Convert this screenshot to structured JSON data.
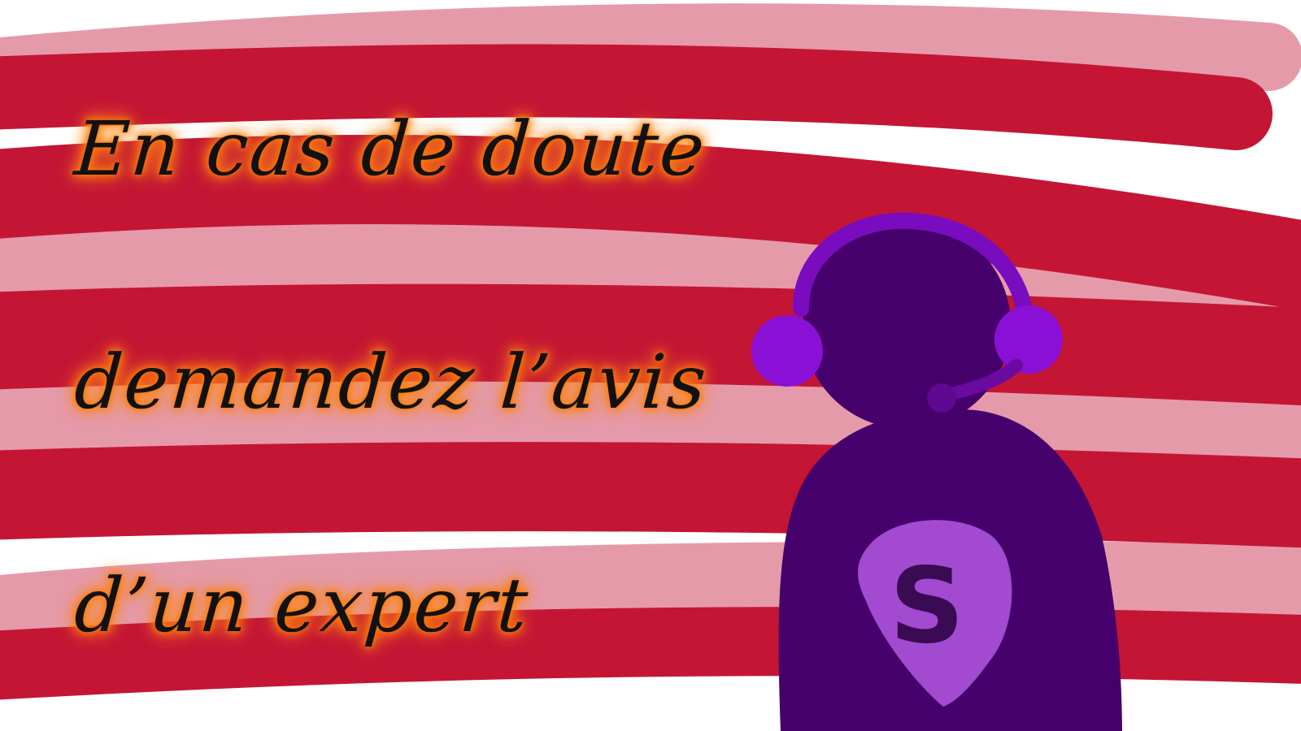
{
  "caption": {
    "line1": "En cas de doute",
    "line2": "demandez l’avis",
    "line3": "d’un expert"
  },
  "figure": {
    "badge_letter": "S",
    "icon": "headset-hero-icon"
  },
  "colors": {
    "background": "#ffffff",
    "stripe_dark": "#c41535",
    "stripe_light": "#e59aaa",
    "text": "#111111",
    "glow": "#ff7a00",
    "body": "#45006b",
    "headset": "#8a10d6",
    "badge": "#a24ad0"
  }
}
